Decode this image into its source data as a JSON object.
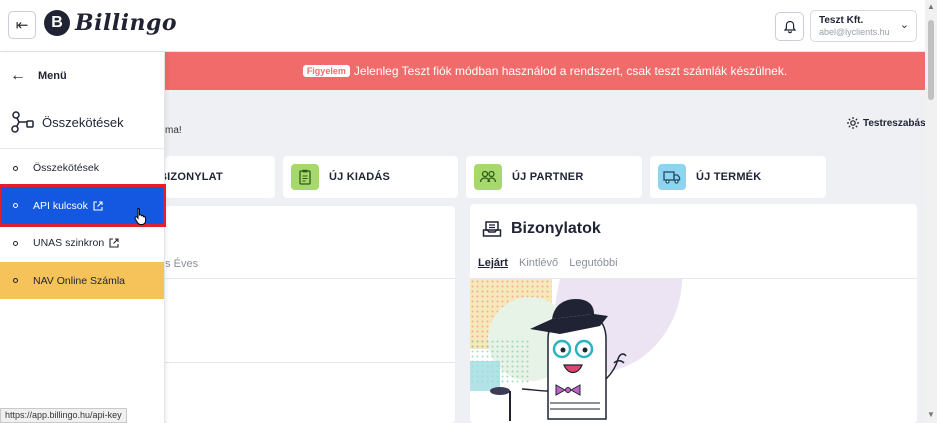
{
  "header": {
    "logo_letter": "B",
    "logo_text": "Billingo",
    "account_name": "Teszt Kft.",
    "account_email": "abel@lyclients.hu"
  },
  "banner": {
    "badge": "Figyelem",
    "message": "Jelenleg Teszt fiók módban használod a rendszert, csak teszt számlák készülnek."
  },
  "main": {
    "greeting_fragment": "ma!",
    "customize_label": "Testreszabás",
    "quick_actions": [
      {
        "label": "BIZONYLAT",
        "icon": "document-icon"
      },
      {
        "label": "ÚJ KIADÁS",
        "icon": "clipboard-icon",
        "color": "#a6d86b"
      },
      {
        "label": "ÚJ PARTNER",
        "icon": "partners-icon",
        "color": "#a6d86b"
      },
      {
        "label": "ÚJ TERMÉK",
        "icon": "truck-icon",
        "color": "#8fd3ee"
      }
    ],
    "left_panel_tabs": "es   Éves",
    "bizonylatok": {
      "title": "Bizonylatok",
      "tabs": [
        "Lejárt",
        "Kintlévő",
        "Legutóbbi"
      ]
    }
  },
  "sidebar": {
    "menu_label": "Menü",
    "section_title": "Összekötések",
    "items": [
      {
        "label": "Összekötések"
      },
      {
        "label": "API kulcsok"
      },
      {
        "label": "UNAS szinkron"
      },
      {
        "label": "NAV Online Számla"
      }
    ]
  },
  "statusbar": {
    "url": "https://app.billingo.hu/api-key"
  },
  "colors": {
    "accent": "#1457e0",
    "banner": "#f26b6b",
    "highlight_outline": "#e0202a",
    "nav_yellow": "#f6c25a"
  }
}
